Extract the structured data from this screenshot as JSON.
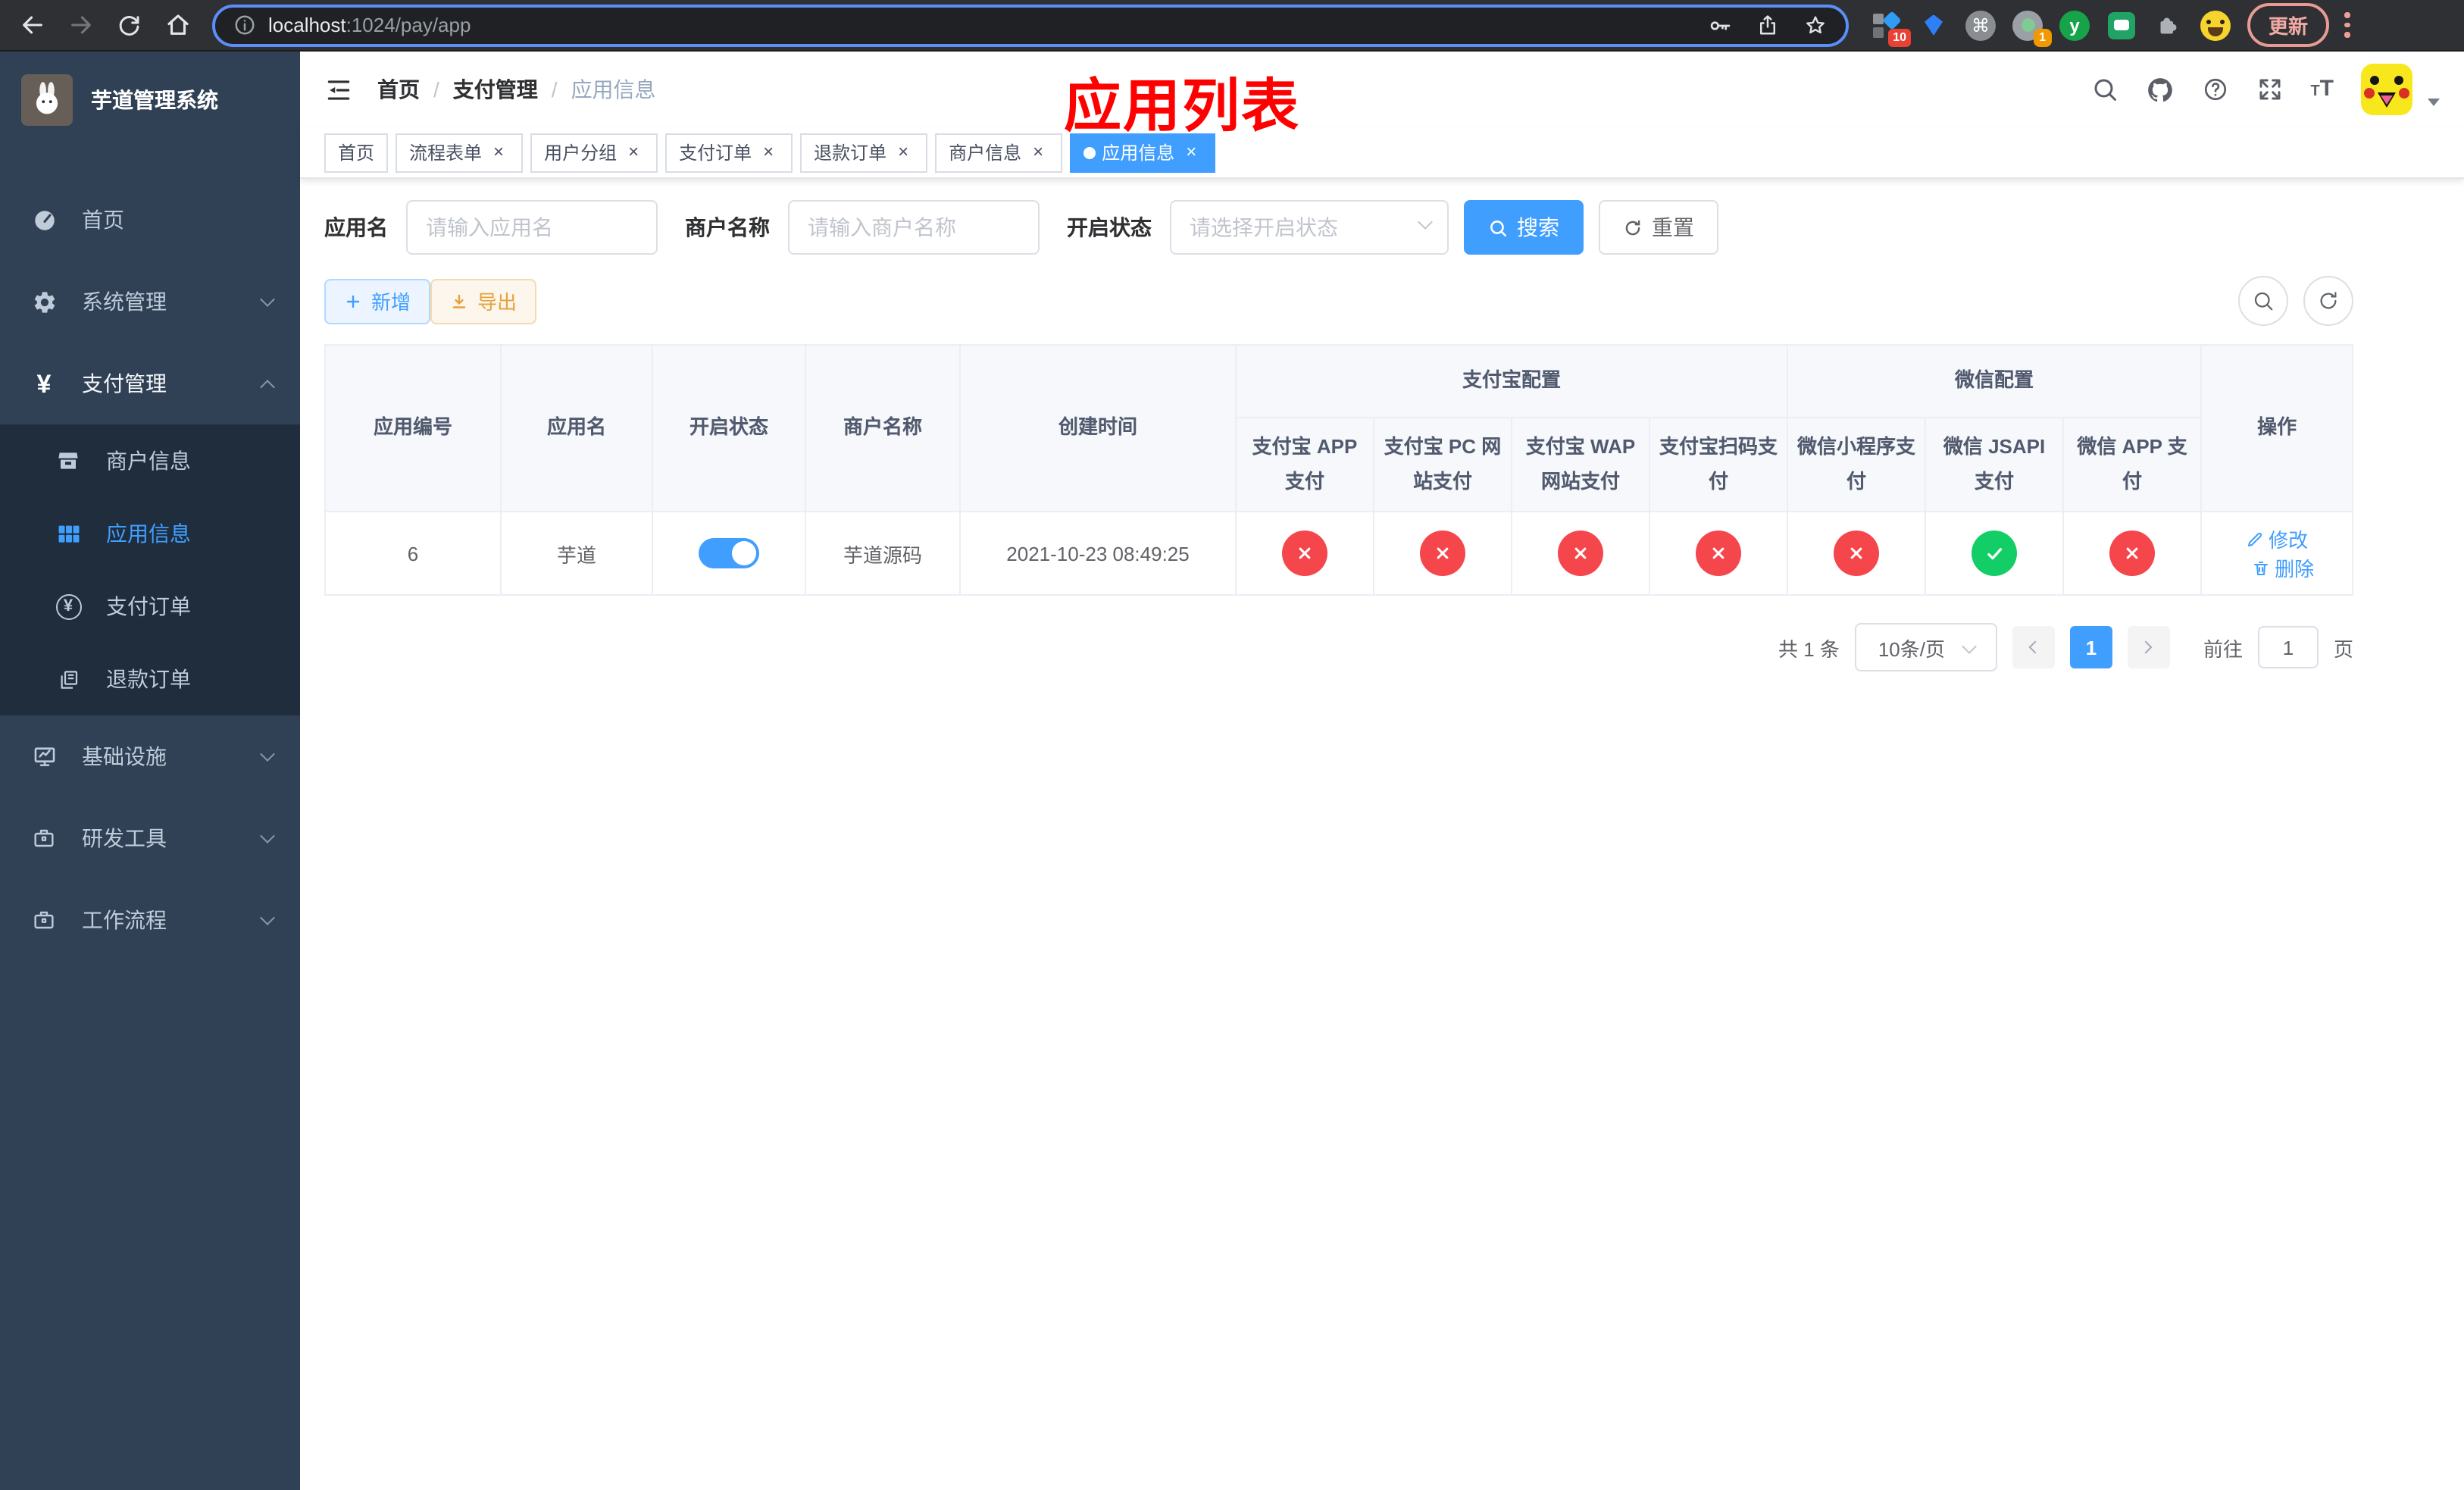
{
  "colors": {
    "primary": "#409eff",
    "danger": "#f5464c",
    "success": "#13ce66",
    "warning": "#e6a23c",
    "sidebar_bg": "#304156",
    "submenu_bg": "#1f2d3d",
    "annotation": "#ff0000"
  },
  "browser": {
    "url_host": "localhost",
    "url_rest": ":1024/pay/app",
    "update_button": "更新",
    "extension_badge_blocks": "10",
    "extension_badge_circle": "1"
  },
  "sidebar": {
    "title": "芋道管理系统",
    "menu_home": "首页",
    "menu_system": "系统管理",
    "menu_pay": "支付管理",
    "sub_merchant": "商户信息",
    "sub_app": "应用信息",
    "sub_pay_order": "支付订单",
    "sub_refund_order": "退款订单",
    "menu_infra": "基础设施",
    "menu_dev_tools": "研发工具",
    "menu_workflow": "工作流程"
  },
  "navbar": {
    "breadcrumb": [
      "首页",
      "支付管理",
      "应用信息"
    ],
    "annotation": "应用列表"
  },
  "tabs": [
    {
      "label": "首页",
      "closable": false,
      "active": false
    },
    {
      "label": "流程表单",
      "closable": true,
      "active": false
    },
    {
      "label": "用户分组",
      "closable": true,
      "active": false
    },
    {
      "label": "支付订单",
      "closable": true,
      "active": false
    },
    {
      "label": "退款订单",
      "closable": true,
      "active": false
    },
    {
      "label": "商户信息",
      "closable": true,
      "active": false
    },
    {
      "label": "应用信息",
      "closable": true,
      "active": true
    }
  ],
  "filters": {
    "app_name_label": "应用名",
    "app_name_placeholder": "请输入应用名",
    "merchant_label": "商户名称",
    "merchant_placeholder": "请输入商户名称",
    "status_label": "开启状态",
    "status_placeholder": "请选择开启状态",
    "search_button": "搜索",
    "reset_button": "重置"
  },
  "toolbar": {
    "add_button": "新增",
    "export_button": "导出"
  },
  "table": {
    "col_id": "应用编号",
    "col_name": "应用名",
    "col_status": "开启状态",
    "col_merchant": "商户名称",
    "col_created": "创建时间",
    "group_alipay": "支付宝配置",
    "group_wechat": "微信配置",
    "col_actions": "操作",
    "sub_columns": [
      "支付宝 APP 支付",
      "支付宝 PC 网站支付",
      "支付宝 WAP 网站支付",
      "支付宝扫码支付",
      "微信小程序支付",
      "微信 JSAPI 支付",
      "微信 APP 支付"
    ],
    "row": {
      "id": "6",
      "name": "芋道",
      "enabled": true,
      "merchant": "芋道源码",
      "created": "2021-10-23 08:49:25",
      "statuses": [
        {
          "state": "danger"
        },
        {
          "state": "danger"
        },
        {
          "state": "danger"
        },
        {
          "state": "danger"
        },
        {
          "state": "danger"
        },
        {
          "state": "success"
        },
        {
          "state": "danger"
        }
      ],
      "edit_label": "修改",
      "delete_label": "删除"
    }
  },
  "pagination": {
    "total": "共 1 条",
    "per_page": "10条/页",
    "page": "1",
    "goto_label": "前往",
    "goto_value": "1",
    "page_unit": "页"
  }
}
